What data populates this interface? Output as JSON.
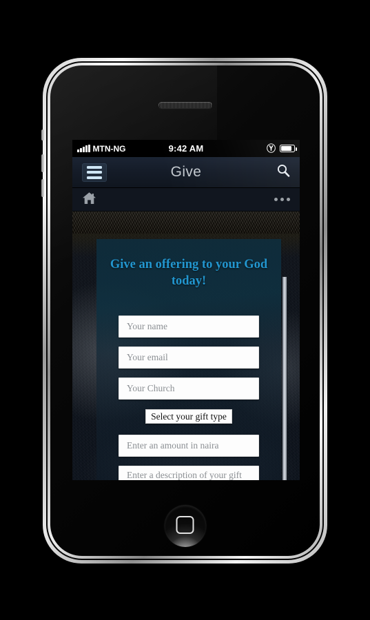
{
  "status_bar": {
    "carrier": "MTN-NG",
    "time": "9:42 AM",
    "signal_icon": "signal-bars-icon",
    "bluetooth_icon": "bluetooth-icon",
    "battery_icon": "battery-icon",
    "battery_level": "86%"
  },
  "title_bar": {
    "menu_icon": "hamburger-menu-icon",
    "title": "Give",
    "search_icon": "search-icon"
  },
  "sub_bar": {
    "home_icon": "home-icon",
    "overflow_icon": "more-options-icon"
  },
  "content": {
    "heading": "Give an offering to your God today!",
    "heading_color": "#2296cf",
    "fields": [
      {
        "name": "name",
        "placeholder": "Your name"
      },
      {
        "name": "email",
        "placeholder": "Your email"
      },
      {
        "name": "church",
        "placeholder": "Your Church"
      }
    ],
    "gift_type_select": "Select your gift type",
    "amount_placeholder": "Enter an amount in naira",
    "description_placeholder": "Enter a description of your gift here"
  },
  "device": {
    "home_button": "home-button",
    "speaker": "earpiece-speaker"
  }
}
